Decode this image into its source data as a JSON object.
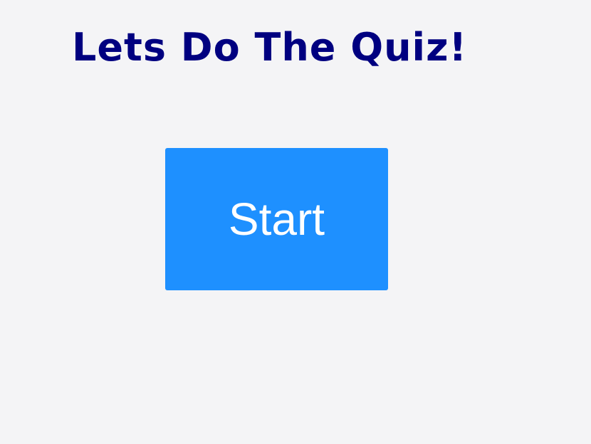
{
  "header": {
    "title": "Lets Do The Quiz!"
  },
  "main": {
    "start_label": "Start"
  },
  "colors": {
    "background": "#f4f4f6",
    "title": "#000080",
    "button_bg": "#1e90ff",
    "button_text": "#ffffff"
  }
}
